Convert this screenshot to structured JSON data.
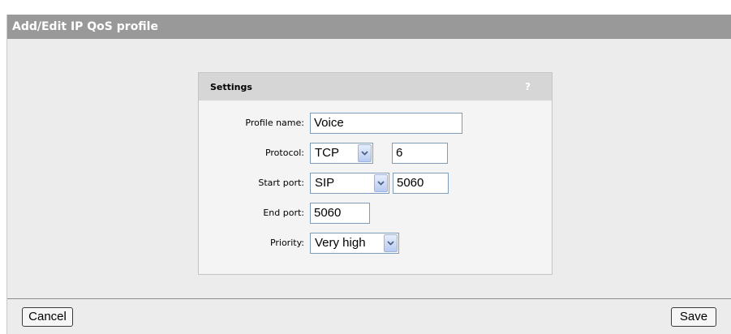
{
  "window": {
    "title": "Add/Edit IP QoS profile"
  },
  "settings": {
    "header": "Settings",
    "help_label": "?",
    "profile_name": {
      "label": "Profile name:",
      "value": "Voice"
    },
    "protocol": {
      "label": "Protocol:",
      "selected": "TCP",
      "number": "6"
    },
    "start_port": {
      "label": "Start port:",
      "selected": "SIP",
      "value": "5060"
    },
    "end_port": {
      "label": "End port:",
      "value": "5060"
    },
    "priority": {
      "label": "Priority:",
      "selected": "Very high"
    }
  },
  "footer": {
    "cancel_label": "Cancel",
    "save_label": "Save"
  },
  "colors": {
    "titlebar": "#999999",
    "background": "#ececec",
    "panel_header": "#d6d6d6",
    "input_border": "#7f9db9"
  }
}
